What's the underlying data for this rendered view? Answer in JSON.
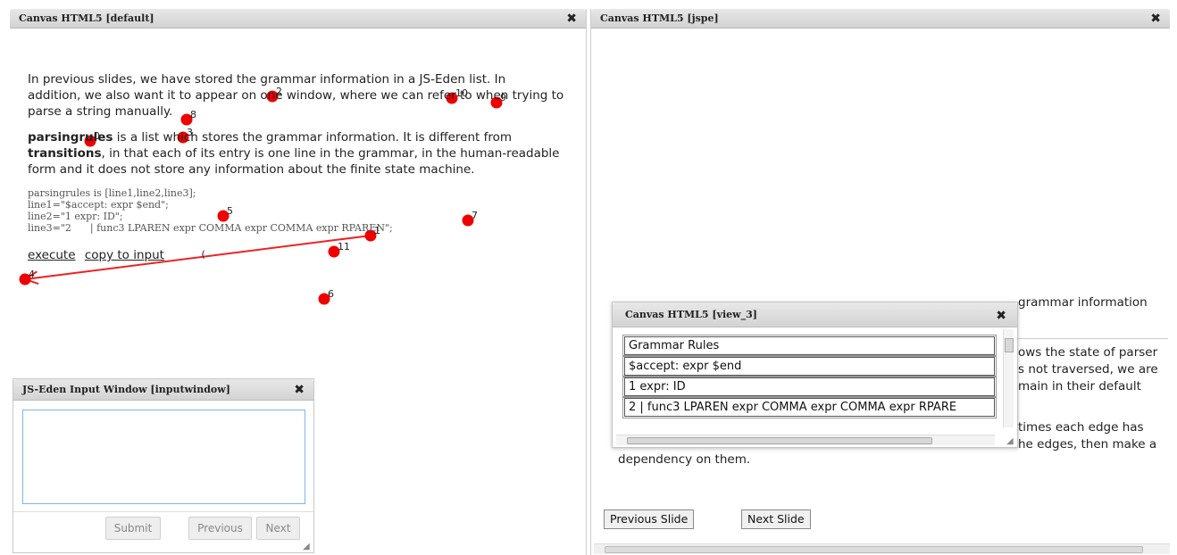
{
  "windows": {
    "default": {
      "title": "Canvas HTML5 [default]",
      "close": "✖"
    },
    "jspe": {
      "title": "Canvas HTML5 [jspe]",
      "close": "✖"
    },
    "input": {
      "title": "JS-Eden Input Window [inputwindow]",
      "close": "✖",
      "textarea_value": "",
      "submit_label": "Submit",
      "previous_label": "Previous",
      "next_label": "Next"
    },
    "view3": {
      "title": "Canvas HTML5 [view_3]",
      "close": "✖",
      "rows": [
        "Grammar Rules",
        "$accept: expr $end",
        "1 expr: ID",
        "2 | func3 LPAREN expr COMMA expr COMMA expr RPARE"
      ]
    }
  },
  "graph": {
    "node_color": "#ee0000",
    "edge_color": "#ee2222",
    "nodes": [
      {
        "id": "0",
        "label": "0"
      },
      {
        "id": "1",
        "label": "1"
      },
      {
        "id": "2",
        "label": "2"
      },
      {
        "id": "3",
        "label": "3"
      },
      {
        "id": "4",
        "label": "4"
      },
      {
        "id": "5",
        "label": "5"
      },
      {
        "id": "6",
        "label": "6"
      },
      {
        "id": "7",
        "label": "7"
      },
      {
        "id": "8",
        "label": "8"
      },
      {
        "id": "9",
        "label": "9"
      },
      {
        "id": "10",
        "label": "10"
      },
      {
        "id": "11",
        "label": "11"
      }
    ],
    "edges": [
      {
        "from": "1",
        "to": "4",
        "label": "("
      }
    ]
  },
  "slide": {
    "para1": [
      "In previous slides, we have stored the grammar information in a JS-Eden list. In",
      "addition, we also want it to appear on one window, where we can refer to when trying to",
      "parse a string manually."
    ],
    "para2_bold1": "parsingrules",
    "para2_line1_rest": " is a list which stores the grammar information. It is different from",
    "para2_bold2": "transitions",
    "para2_line2_rest": ", in that each of its entry is one line in the grammar, in the human-readable",
    "para2_line3": "form and it does not store any information about the finite state machine.",
    "code": "parsingrules is [line1,line2,line3];\nline1=\"$accept: expr $end\";\nline2=\"1 expr: ID\";\nline3=\"2      | func3 LPAREN expr COMMA expr COMMA expr RPAREN\";",
    "link_execute": "execute",
    "link_copy": "copy to input",
    "para3_partial": "grammar information",
    "para4_lines": [
      "ows the state of parser",
      "s not traversed, we are",
      "main in their default"
    ],
    "para5_lines": [
      "times each edge has",
      "he edges, then make a"
    ],
    "para5_end": "dependency on them.",
    "prev_label": "Previous Slide",
    "next_label": "Next Slide"
  }
}
